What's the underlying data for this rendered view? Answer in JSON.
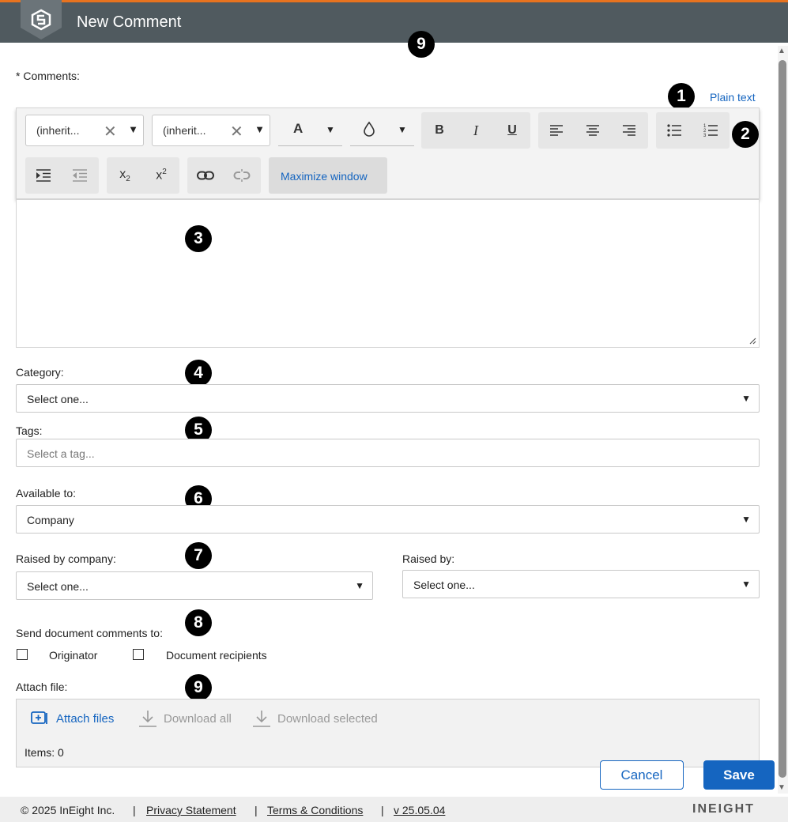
{
  "header": {
    "title": "New Comment"
  },
  "badges": {
    "b1": "1",
    "b2": "2",
    "b3": "3",
    "b4": "4",
    "b5": "5",
    "b6": "6",
    "b7": "7",
    "b8": "8",
    "b9a": "9",
    "b9b": "9"
  },
  "comments": {
    "label": "* Comments:",
    "plain_text_link": "Plain text",
    "toolbar": {
      "font_family": "(inherit...",
      "font_size": "(inherit...",
      "maximize_label": "Maximize window",
      "font_color_glyph": "A",
      "bold_glyph": "B",
      "italic_glyph": "I",
      "underline_glyph": "U"
    }
  },
  "category": {
    "label": "Category:",
    "value": "Select one..."
  },
  "tags": {
    "label": "Tags:",
    "placeholder": "Select a tag..."
  },
  "available_to": {
    "label": "Available to:",
    "value": "Company"
  },
  "raised_by_company": {
    "label": "Raised by company:",
    "value": "Select one..."
  },
  "raised_by": {
    "label": "Raised by:",
    "value": "Select one..."
  },
  "send_comments": {
    "label": "Send document comments to:",
    "originator": "Originator",
    "document_recipients": "Document recipients"
  },
  "attach": {
    "label": "Attach file:",
    "attach_files": "Attach files",
    "download_all": "Download all",
    "download_selected": "Download selected",
    "items": "Items: 0"
  },
  "actions": {
    "cancel": "Cancel",
    "save": "Save"
  },
  "footer": {
    "copyright": "© 2025 InEight Inc.",
    "sep": "|",
    "privacy": "Privacy Statement",
    "terms": "Terms & Conditions",
    "version": "v 25.05.04",
    "brand": "INEIGHT"
  },
  "colors": {
    "header_bg": "#505a5f",
    "accent_orange": "#e8731f",
    "primary_blue": "#1565c0"
  }
}
